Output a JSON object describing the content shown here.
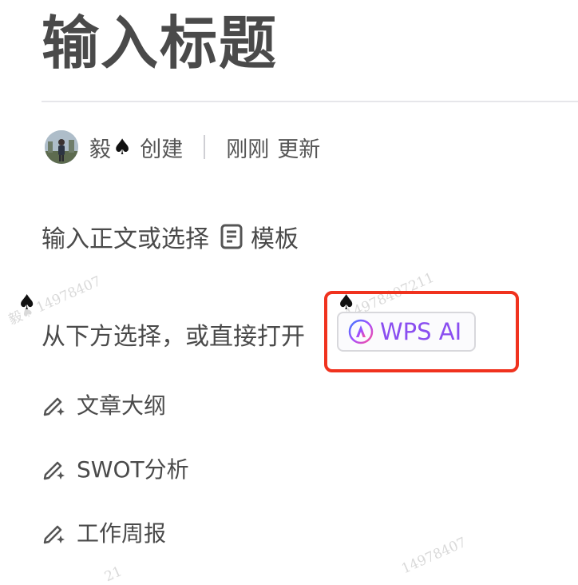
{
  "document": {
    "title": "输入标题",
    "body_placeholder": "输入正文或选择",
    "template_label": "模板",
    "choose_prompt": "从下方选择，或直接打开",
    "ai_button_label": "WPS AI"
  },
  "meta": {
    "author_name": "毅",
    "author_suffix": "♠",
    "created_label": "创建",
    "updated_time": "刚刚",
    "updated_label": "更新"
  },
  "options": [
    {
      "label": "文章大纲",
      "icon": "pen-sparkle-icon"
    },
    {
      "label": "SWOT分析",
      "icon": "pen-sparkle-icon"
    },
    {
      "label": "工作周报",
      "icon": "pen-sparkle-icon"
    }
  ],
  "watermark": {
    "text_a": "毅♠ 14978407",
    "text_b": "14978407211",
    "text_c": "14978407",
    "text_d": "21"
  },
  "colors": {
    "accent_ai": "#8a4ef0",
    "highlight": "#f0321e"
  }
}
